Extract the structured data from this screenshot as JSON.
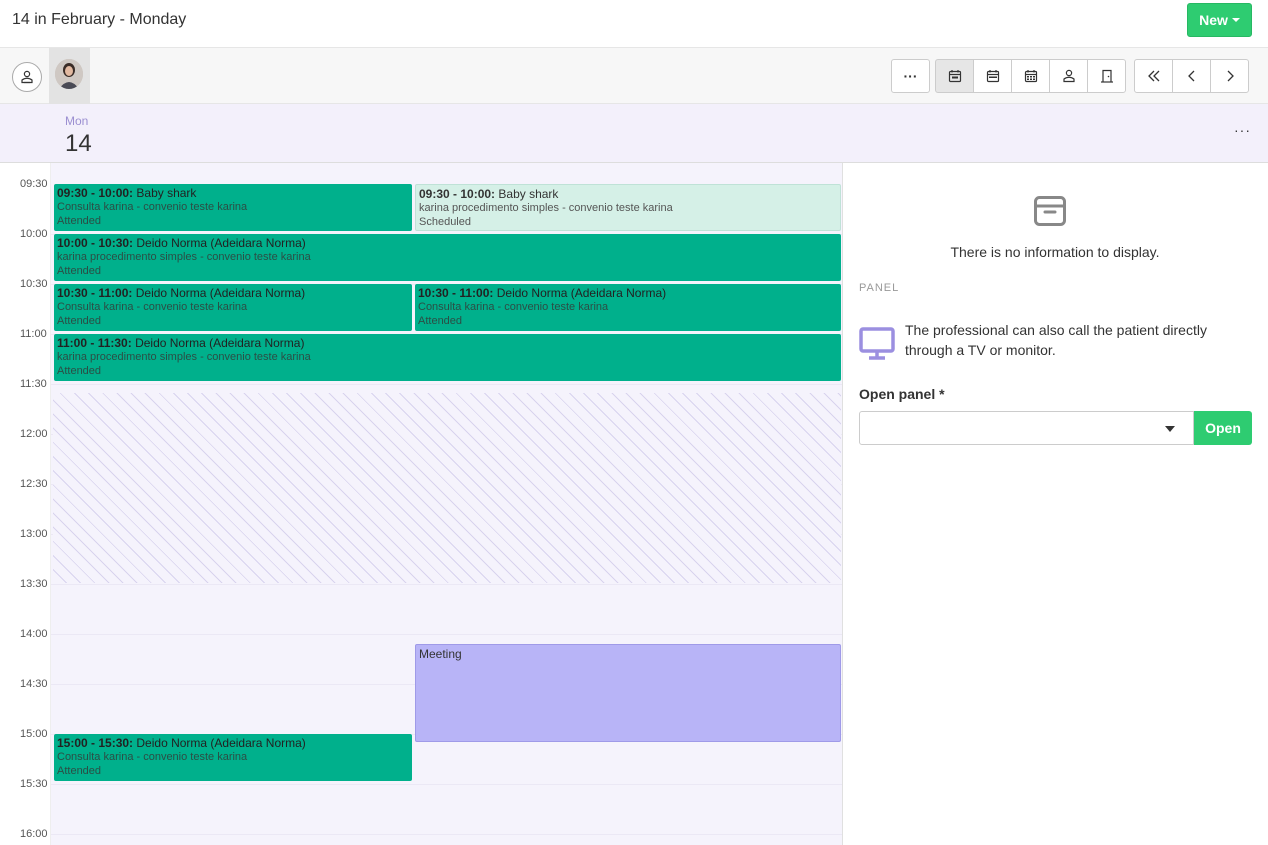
{
  "header": {
    "title": "14 in February - Monday",
    "new_label": "New"
  },
  "toolbar": {
    "more_label": "···",
    "view_icons": [
      "day-view-icon",
      "week-view-icon",
      "month-view-icon",
      "professional-view-icon",
      "room-view-icon"
    ],
    "nav_icons": [
      "double-chevron-left-icon",
      "chevron-left-icon",
      "chevron-right-icon"
    ]
  },
  "day_header": {
    "weekday": "Mon",
    "day": "14",
    "more_label": "···"
  },
  "times": [
    "09:30",
    "10:00",
    "10:30",
    "11:00",
    "11:30",
    "12:00",
    "12:30",
    "13:00",
    "13:30",
    "14:00",
    "14:30",
    "15:00",
    "15:30",
    "16:00"
  ],
  "events": [
    {
      "time": "09:30 - 10:00:",
      "name": "Baby shark",
      "detail": "Consulta karina - convenio teste karina",
      "status": "Attended"
    },
    {
      "time": "09:30 - 10:00:",
      "name": "Baby shark",
      "detail": "karina procedimento simples - convenio teste karina",
      "status": "Scheduled"
    },
    {
      "time": "10:00 - 10:30:",
      "name": "Deido Norma (Adeidara Norma)",
      "detail": "karina procedimento simples - convenio teste karina",
      "status": "Attended"
    },
    {
      "time": "10:30 - 11:00:",
      "name": "Deido Norma (Adeidara Norma)",
      "detail": "Consulta karina - convenio teste karina",
      "status": "Attended"
    },
    {
      "time": "10:30 - 11:00:",
      "name": "Deido Norma (Adeidara Norma)",
      "detail": "Consulta karina - convenio teste karina",
      "status": "Attended"
    },
    {
      "time": "11:00 - 11:30:",
      "name": "Deido Norma (Adeidara Norma)",
      "detail": "karina procedimento simples - convenio teste karina",
      "status": "Attended"
    },
    {
      "time": "",
      "name": "Meeting",
      "detail": "",
      "status": ""
    },
    {
      "time": "15:00 - 15:30:",
      "name": "Deido Norma (Adeidara Norma)",
      "detail": "Consulta karina - convenio teste karina",
      "status": "Attended"
    }
  ],
  "panel": {
    "empty_text": "There is no information to display.",
    "section_label": "PANEL",
    "tv_text": "The professional can also call the patient directly through a TV or monitor.",
    "open_panel_label": "Open panel *",
    "open_panel_value": "",
    "open_button": "Open"
  },
  "colors": {
    "accent_green": "#2ecc71",
    "attended": "#00b08c",
    "scheduled": "#d5f0e7",
    "meeting": "#b8b4f7",
    "calendar_bg": "#f5f3fc",
    "icon_purple": "#9b8fe0"
  }
}
